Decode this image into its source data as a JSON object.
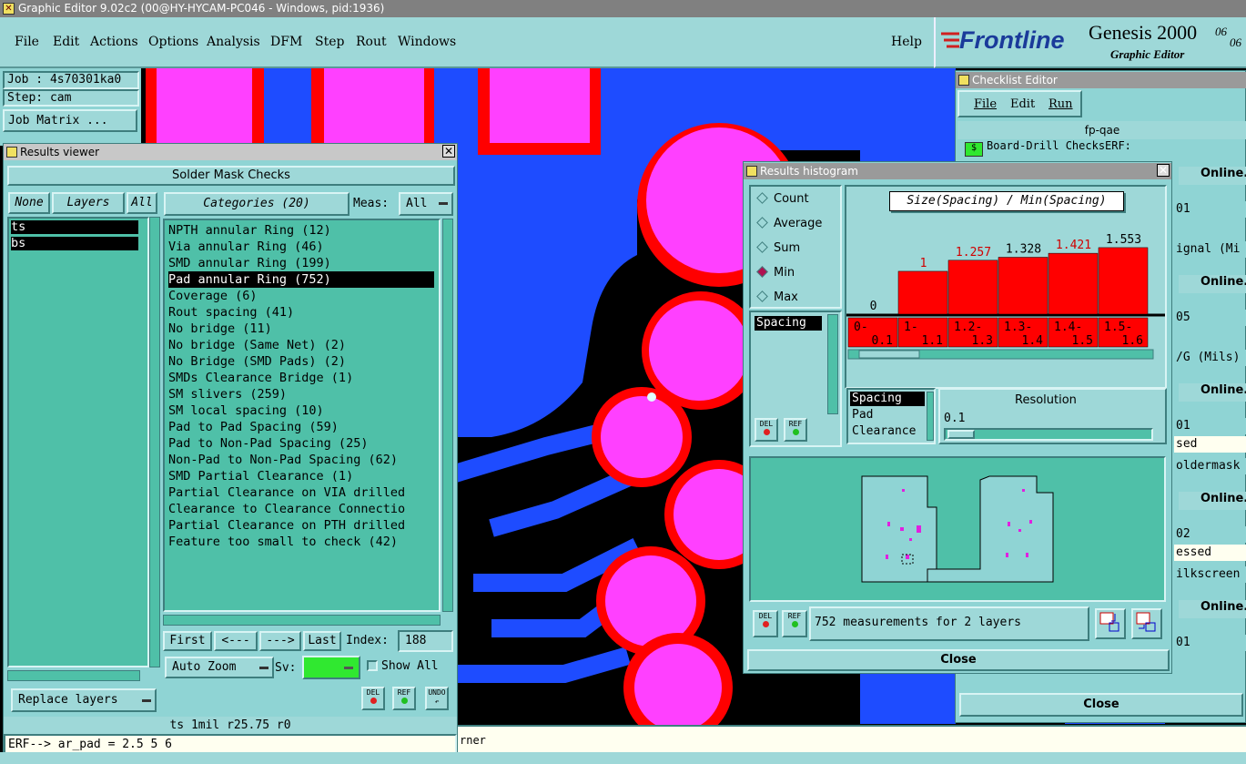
{
  "app": {
    "title": "Graphic Editor 9.02c2 (00@HY-HYCAM-PC046 - Windows, pid:1936)"
  },
  "menu": {
    "file": "File",
    "edit": "Edit",
    "actions": "Actions",
    "options": "Options",
    "analysis": "Analysis",
    "dfm": "DFM",
    "step": "Step",
    "rout": "Rout",
    "windows": "Windows",
    "help": "Help"
  },
  "brand": {
    "logo": "Frontline",
    "product": "Genesis 2000",
    "sub": "Graphic Editor",
    "date1": "06",
    "date2": "06"
  },
  "job": {
    "job": "Job : 4s70301ka0",
    "step": "Step: cam",
    "matrix": "Job Matrix ..."
  },
  "results_viewer": {
    "title": "Results viewer",
    "header": "Solder Mask Checks",
    "none": "None",
    "layers": "Layers",
    "all": "All",
    "categories_btn": "Categories (20)",
    "meas_label": "Meas:",
    "meas_value": "All",
    "layer_list": [
      "ts",
      "bs"
    ],
    "categories": [
      "NPTH annular Ring (12)",
      "Via annular Ring (46)",
      "SMD annular Ring (199)",
      "Pad annular Ring (752)",
      "Coverage (6)",
      "Rout spacing (41)",
      "No bridge (11)",
      "No bridge (Same Net) (2)",
      "No Bridge (SMD Pads) (2)",
      "SMDs Clearance Bridge (1)",
      "SM slivers (259)",
      "SM local spacing (10)",
      "Pad to Pad Spacing (59)",
      "Pad to Non-Pad Spacing (25)",
      "Non-Pad to Non-Pad Spacing (62)",
      "SMD Partial Clearance (1)",
      "Partial Clearance on VIA drilled",
      "Clearance to Clearance Connectio",
      "Partial Clearance on PTH drilled",
      "Feature too small to check (42)"
    ],
    "first": "First",
    "prev": "<---",
    "next": "--->",
    "last": "Last",
    "index_label": "Index:",
    "index_value": "188",
    "auto_zoom": "Auto Zoom",
    "sv_label": "Sv:",
    "show_all": "Show All",
    "replace_layers": "Replace layers",
    "del": "DEL",
    "ref": "REF",
    "undo": "UNDO"
  },
  "status": {
    "line1": "ts 1mil r25.75 r0",
    "line2": "ERF--> ar_pad = 2.5 5 6",
    "corner": "rner"
  },
  "histogram": {
    "title": "Results histogram",
    "modes": [
      "Count",
      "Average",
      "Sum",
      "Min",
      "Max"
    ],
    "selected_mode": "Min",
    "chart_title": "Size(Spacing) / Min(Spacing)",
    "list": [
      "Spacing"
    ],
    "bars": [
      {
        "label": "0",
        "range": "0-\n0.1",
        "value": 0
      },
      {
        "label": "1",
        "range": "1-\n1.1",
        "value": 1
      },
      {
        "label": "1.257",
        "range": "1.2-\n1.3",
        "value": 1.257
      },
      {
        "label": "1.328",
        "range": "1.3-\n1.4",
        "value": 1.328
      },
      {
        "label": "1.421",
        "range": "1.4-\n1.5",
        "value": 1.421
      },
      {
        "label": "1.553",
        "range": "1.5-\n1.6",
        "value": 1.553
      }
    ],
    "label_colors": [
      "#000000",
      "#d00000",
      "#d00000",
      "#000000",
      "#d00000",
      "#000000"
    ],
    "attrs": [
      "Spacing",
      "Pad",
      "Clearance"
    ],
    "resolution_label": "Resolution",
    "resolution_value": "0.1",
    "summary": "752 measurements for 2 layers",
    "close": "Close"
  },
  "checklist": {
    "title": "Checklist Editor",
    "file": "File",
    "edit": "Edit",
    "run": "Run",
    "name": "fp-qae",
    "row0": "Board-Drill Checks",
    "erf": "ERF:",
    "online": "Online.",
    "frag": [
      "01",
      "ignal (Mi",
      "05",
      "/G (Mils)",
      "01",
      "sed",
      "oldermask",
      "02",
      "essed",
      "ilkscreen",
      "01"
    ],
    "close": "Close"
  },
  "colors": {
    "panel": "#8fd4d4",
    "list": "#4fc0a8",
    "pad_fill": "#ff40ff",
    "pad_ring": "#ff0000",
    "trace": "#1e4cff",
    "highlight": "#000000"
  }
}
